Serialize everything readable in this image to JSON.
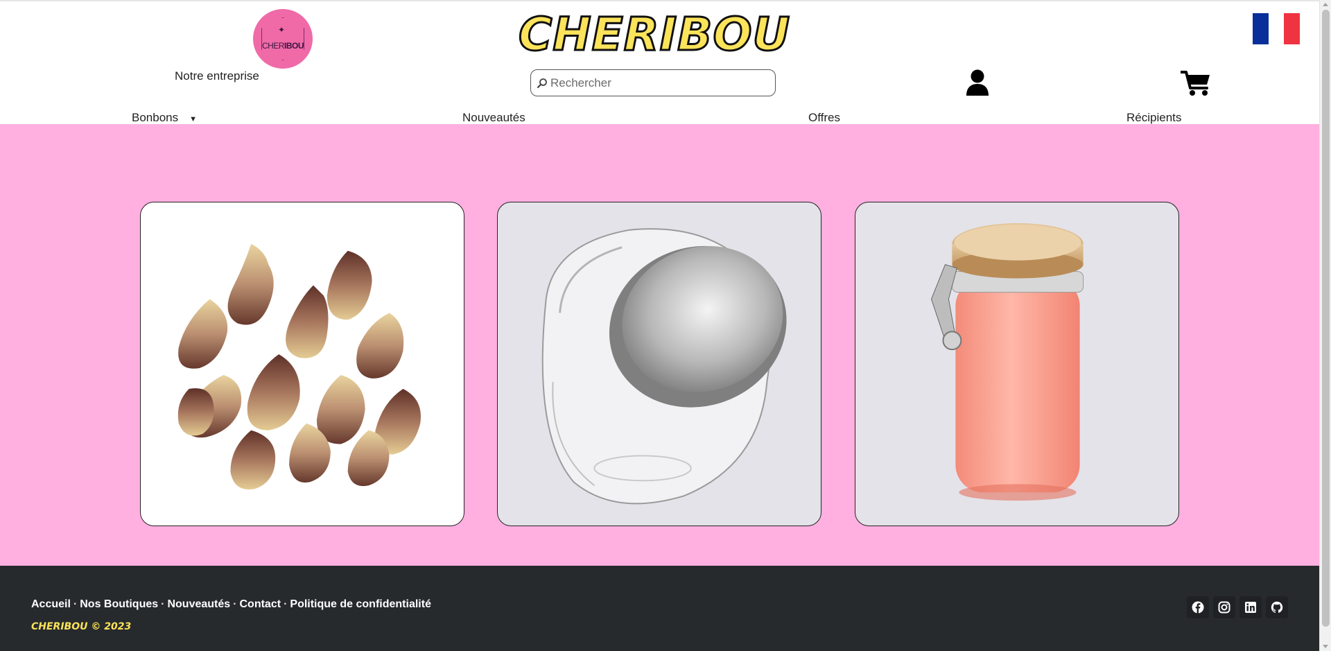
{
  "header": {
    "badge_text_light": "CHER",
    "badge_text_bold": "IBOU",
    "company_link": "Notre entreprise",
    "brand_title": "CHERIBOU",
    "search": {
      "placeholder": "Rechercher",
      "value": ""
    },
    "flag_colors": [
      "#0b2f9a",
      "#ffffff",
      "#ef3340"
    ]
  },
  "nav": {
    "items": [
      {
        "label": "Bonbons",
        "has_dropdown": true,
        "caret": "▼"
      },
      {
        "label": "Nouveautés"
      },
      {
        "label": "Offres"
      },
      {
        "label": "Récipients"
      }
    ]
  },
  "main": {
    "background": "#ffb0e0",
    "cards": [
      {
        "subject": "cola gummy candies"
      },
      {
        "subject": "glass candy jar with steel lid"
      },
      {
        "subject": "pink glass jar with bamboo lid"
      }
    ]
  },
  "footer": {
    "links": [
      "Accueil",
      "Nos Boutiques",
      "Nouveautés",
      "Contact",
      "Politique de confidentialité"
    ],
    "separator": "·",
    "copyright": "CHERIBOU © 2023",
    "socials": [
      "facebook-icon",
      "instagram-icon",
      "linkedin-icon",
      "github-icon"
    ]
  }
}
